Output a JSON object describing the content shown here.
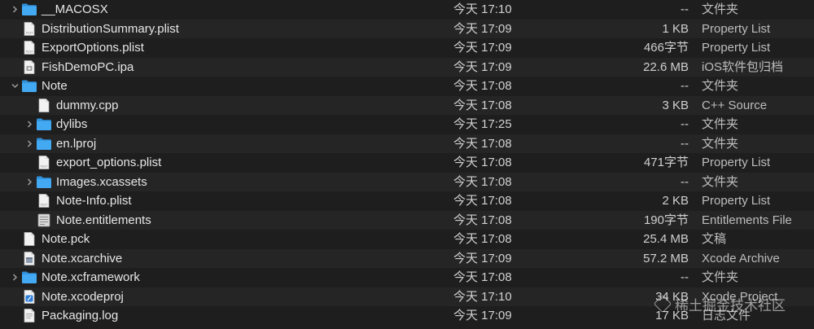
{
  "files": [
    {
      "name": "__MACOSX",
      "date": "今天 17:10",
      "size": "--",
      "kind": "文件夹",
      "icon": "folder-icon",
      "level": 0,
      "chevron": "right"
    },
    {
      "name": "DistributionSummary.plist",
      "date": "今天 17:09",
      "size": "1 KB",
      "kind": "Property List",
      "icon": "plist-file-icon",
      "level": 0,
      "chevron": ""
    },
    {
      "name": "ExportOptions.plist",
      "date": "今天 17:09",
      "size": "466字节",
      "kind": "Property List",
      "icon": "plist-file-icon",
      "level": 0,
      "chevron": ""
    },
    {
      "name": "FishDemoPC.ipa",
      "date": "今天 17:09",
      "size": "22.6 MB",
      "kind": "iOS软件包归档",
      "icon": "ipa-file-icon",
      "level": 0,
      "chevron": ""
    },
    {
      "name": "Note",
      "date": "今天 17:08",
      "size": "--",
      "kind": "文件夹",
      "icon": "folder-icon",
      "level": 0,
      "chevron": "down"
    },
    {
      "name": "dummy.cpp",
      "date": "今天 17:08",
      "size": "3 KB",
      "kind": "C++ Source",
      "icon": "document-icon",
      "level": 1,
      "chevron": ""
    },
    {
      "name": "dylibs",
      "date": "今天 17:25",
      "size": "--",
      "kind": "文件夹",
      "icon": "folder-icon",
      "level": 1,
      "chevron": "right"
    },
    {
      "name": "en.lproj",
      "date": "今天 17:08",
      "size": "--",
      "kind": "文件夹",
      "icon": "folder-icon",
      "level": 1,
      "chevron": "right"
    },
    {
      "name": "export_options.plist",
      "date": "今天 17:08",
      "size": "471字节",
      "kind": "Property List",
      "icon": "plist-file-icon",
      "level": 1,
      "chevron": ""
    },
    {
      "name": "Images.xcassets",
      "date": "今天 17:08",
      "size": "--",
      "kind": "文件夹",
      "icon": "folder-icon",
      "level": 1,
      "chevron": "right"
    },
    {
      "name": "Note-Info.plist",
      "date": "今天 17:08",
      "size": "2 KB",
      "kind": "Property List",
      "icon": "plist-file-icon",
      "level": 1,
      "chevron": ""
    },
    {
      "name": "Note.entitlements",
      "date": "今天 17:08",
      "size": "190字节",
      "kind": "Entitlements File",
      "icon": "entitlements-file-icon",
      "level": 1,
      "chevron": ""
    },
    {
      "name": "Note.pck",
      "date": "今天 17:08",
      "size": "25.4 MB",
      "kind": "文稿",
      "icon": "document-icon",
      "level": 0,
      "chevron": ""
    },
    {
      "name": "Note.xcarchive",
      "date": "今天 17:09",
      "size": "57.2 MB",
      "kind": "Xcode Archive",
      "icon": "xcarchive-icon",
      "level": 0,
      "chevron": ""
    },
    {
      "name": "Note.xcframework",
      "date": "今天 17:08",
      "size": "--",
      "kind": "文件夹",
      "icon": "folder-icon",
      "level": 0,
      "chevron": "right"
    },
    {
      "name": "Note.xcodeproj",
      "date": "今天 17:10",
      "size": "34 KB",
      "kind": "Xcode Project",
      "icon": "xcodeproj-icon",
      "level": 0,
      "chevron": ""
    },
    {
      "name": "Packaging.log",
      "date": "今天 17:09",
      "size": "17 KB",
      "kind": "日志文件",
      "icon": "log-file-icon",
      "level": 0,
      "chevron": ""
    }
  ],
  "watermark": {
    "text": "稀土掘金技术社区",
    "icon": "juejin-logo-icon"
  },
  "colors": {
    "background": "#1e1e1e",
    "alt_row": "#252525",
    "folder": "#39a2f0",
    "text": "#dcdcdc"
  }
}
